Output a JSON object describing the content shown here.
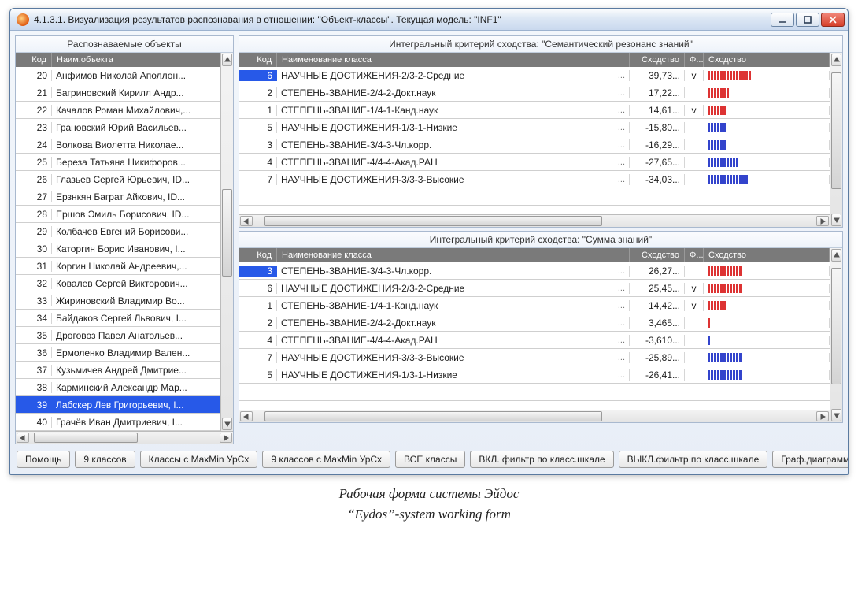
{
  "window": {
    "title": "4.1.3.1. Визуализация результатов распознавания в отношении: \"Объект-классы\". Текущая модель: \"INF1\""
  },
  "left": {
    "title": "Распознаваемые объекты",
    "headers": {
      "code": "Код",
      "name": "Наим.объекта"
    },
    "rows": [
      {
        "code": 20,
        "name": "Анфимов Николай Аполлон..."
      },
      {
        "code": 21,
        "name": "Багриновский Кирилл Андр..."
      },
      {
        "code": 22,
        "name": "Качалов Роман Михайлович,..."
      },
      {
        "code": 23,
        "name": "Грановский Юрий Васильев..."
      },
      {
        "code": 24,
        "name": "Волкова Виолетта Николае..."
      },
      {
        "code": 25,
        "name": "Береза Татьяна Никифоров..."
      },
      {
        "code": 26,
        "name": "Глазьев Сергей Юрьевич, ID..."
      },
      {
        "code": 27,
        "name": "Ерзнкян Баграт Айкович, ID..."
      },
      {
        "code": 28,
        "name": "Ершов Эмиль Борисович, ID..."
      },
      {
        "code": 29,
        "name": "Колбачев Евгений Борисови..."
      },
      {
        "code": 30,
        "name": "Каторгин Борис Иванович, I..."
      },
      {
        "code": 31,
        "name": "Коргин Николай Андреевич,..."
      },
      {
        "code": 32,
        "name": "Ковалев Сергей Викторович..."
      },
      {
        "code": 33,
        "name": "Жириновский Владимир Во..."
      },
      {
        "code": 34,
        "name": "Байдаков Сергей Львович, I..."
      },
      {
        "code": 35,
        "name": "Дроговоз Павел Анатольев..."
      },
      {
        "code": 36,
        "name": "Ермоленко Владимир Вален..."
      },
      {
        "code": 37,
        "name": "Кузьмичев Андрей Дмитрие..."
      },
      {
        "code": 38,
        "name": "Карминский Александр Мар..."
      },
      {
        "code": 39,
        "name": "Лабскер Лев Григорьевич, I...",
        "selected": true
      },
      {
        "code": 40,
        "name": "Грачёв Иван Дмитриевич, I..."
      }
    ]
  },
  "top": {
    "title": "Интегральный критерий сходства: \"Семантический резонанс знаний\"",
    "headers": {
      "code": "Код",
      "name": "Наименование класса",
      "sim": "Сходство",
      "f": "Ф...",
      "bar": "Сходство"
    },
    "rows": [
      {
        "code": 6,
        "name": "НАУЧНЫЕ ДОСТИЖЕНИЯ-2/3-2-Средние",
        "sim": "39,73...",
        "f": "v",
        "bars": 14,
        "selected": true
      },
      {
        "code": 2,
        "name": "СТЕПЕНЬ-ЗВАНИЕ-2/4-2-Докт.наук",
        "sim": "17,22...",
        "f": "",
        "bars": 7
      },
      {
        "code": 1,
        "name": "СТЕПЕНЬ-ЗВАНИЕ-1/4-1-Канд.наук",
        "sim": "14,61...",
        "f": "v",
        "bars": 6
      },
      {
        "code": 5,
        "name": "НАУЧНЫЕ ДОСТИЖЕНИЯ-1/3-1-Низкие",
        "sim": "-15,80...",
        "f": "",
        "bars": 6,
        "neg": true
      },
      {
        "code": 3,
        "name": "СТЕПЕНЬ-ЗВАНИЕ-3/4-3-Чл.корр.",
        "sim": "-16,29...",
        "f": "",
        "bars": 6,
        "neg": true
      },
      {
        "code": 4,
        "name": "СТЕПЕНЬ-ЗВАНИЕ-4/4-4-Акад.РАН",
        "sim": "-27,65...",
        "f": "",
        "bars": 10,
        "neg": true
      },
      {
        "code": 7,
        "name": "НАУЧНЫЕ ДОСТИЖЕНИЯ-3/3-3-Высокие",
        "sim": "-34,03...",
        "f": "",
        "bars": 13,
        "neg": true
      }
    ]
  },
  "bottom": {
    "title": "Интегральный критерий сходства: \"Сумма знаний\"",
    "headers": {
      "code": "Код",
      "name": "Наименование класса",
      "sim": "Сходство",
      "f": "Ф...",
      "bar": "Сходство"
    },
    "rows": [
      {
        "code": 3,
        "name": "СТЕПЕНЬ-ЗВАНИЕ-3/4-3-Чл.корр.",
        "sim": "26,27...",
        "f": "",
        "bars": 11,
        "selected": true
      },
      {
        "code": 6,
        "name": "НАУЧНЫЕ ДОСТИЖЕНИЯ-2/3-2-Средние",
        "sim": "25,45...",
        "f": "v",
        "bars": 11
      },
      {
        "code": 1,
        "name": "СТЕПЕНЬ-ЗВАНИЕ-1/4-1-Канд.наук",
        "sim": "14,42...",
        "f": "v",
        "bars": 6
      },
      {
        "code": 2,
        "name": "СТЕПЕНЬ-ЗВАНИЕ-2/4-2-Докт.наук",
        "sim": "3,465...",
        "f": "",
        "bars": 1
      },
      {
        "code": 4,
        "name": "СТЕПЕНЬ-ЗВАНИЕ-4/4-4-Акад.РАН",
        "sim": "-3,610...",
        "f": "",
        "bars": 1,
        "neg": true
      },
      {
        "code": 7,
        "name": "НАУЧНЫЕ ДОСТИЖЕНИЯ-3/3-3-Высокие",
        "sim": "-25,89...",
        "f": "",
        "bars": 11,
        "neg": true
      },
      {
        "code": 5,
        "name": "НАУЧНЫЕ ДОСТИЖЕНИЯ-1/3-1-Низкие",
        "sim": "-26,41...",
        "f": "",
        "bars": 11,
        "neg": true
      }
    ]
  },
  "buttons": [
    "Помощь",
    "9 классов",
    "Классы с MaxMin УрСх",
    "9 классов с MaxMin УрСх",
    "ВСЕ классы",
    "ВКЛ. фильтр по класс.шкале",
    "ВЫКЛ.фильтр по класс.шкале",
    "Граф.диаграмма"
  ],
  "captions": {
    "ru": "Рабочая форма системы Эйдос",
    "en": "“Eydos”-system working form"
  }
}
